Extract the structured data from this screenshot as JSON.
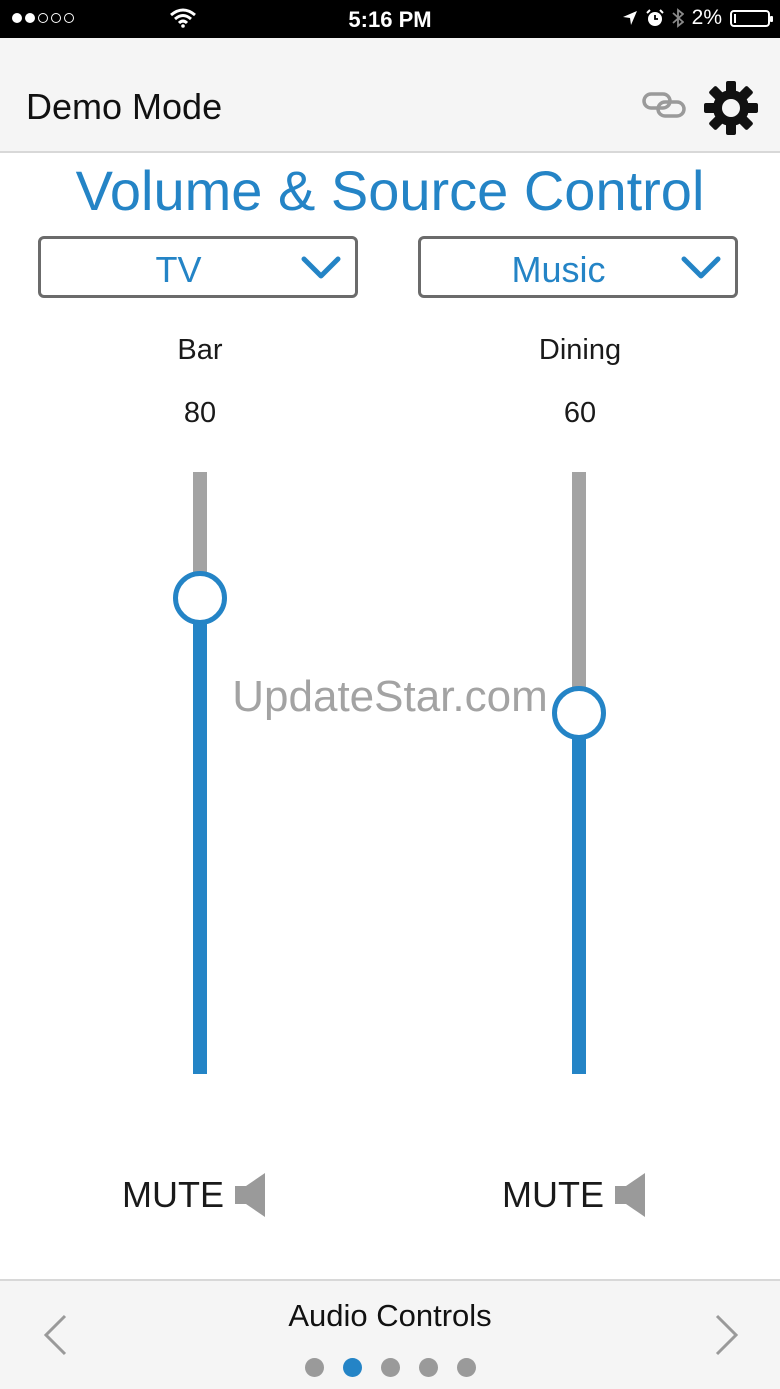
{
  "status_bar": {
    "time": "5:16 PM",
    "battery": "2%",
    "signal_filled": 2,
    "signal_total": 5
  },
  "header": {
    "title": "Demo Mode"
  },
  "page_title": "Volume & Source Control",
  "zones": [
    {
      "source": "TV",
      "name": "Bar",
      "volume": "80",
      "level_fraction": 0.79,
      "mute_label": "MUTE"
    },
    {
      "source": "Music",
      "name": "Dining",
      "volume": "60",
      "level_fraction": 0.6,
      "mute_label": "MUTE"
    }
  ],
  "watermark": "UpdateStar.com",
  "footer": {
    "title": "Audio Controls",
    "page_count": 5,
    "active_page": 2
  },
  "colors": {
    "accent": "#2484c6",
    "track": "#a3a3a3",
    "icon_gray": "#9a9a9a"
  },
  "icons": [
    "wifi-icon",
    "location-arrow-icon",
    "alarm-clock-icon",
    "bluetooth-icon",
    "battery-icon",
    "link-icon",
    "gear-icon",
    "chevron-down-icon",
    "speaker-icon",
    "chevron-left-icon",
    "chevron-right-icon"
  ]
}
